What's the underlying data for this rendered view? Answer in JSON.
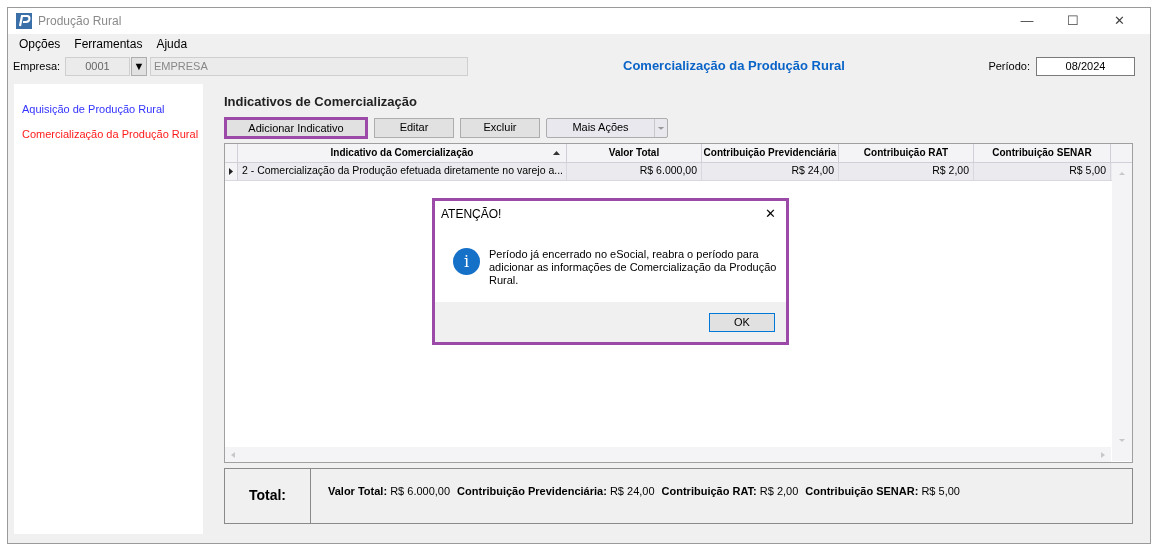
{
  "window": {
    "title": "Produção Rural",
    "controls": [
      "—",
      "☐",
      "✕"
    ]
  },
  "menu": [
    "Opções",
    "Ferramentas",
    "Ajuda"
  ],
  "empresa": {
    "label": "Empresa:",
    "code": "0001",
    "dropdown": "▼",
    "name": "EMPRESA"
  },
  "heading": "Comercialização da Produção Rural",
  "periodo": {
    "label": "Período:",
    "value": "08/2024"
  },
  "sidebar": {
    "items": [
      {
        "label": "Aquisição de Produção Rural",
        "selected": false
      },
      {
        "label": "Comercialização da Produção Rural",
        "selected": true
      }
    ]
  },
  "section_title": "Indicativos de Comercialização",
  "toolbar": {
    "buttons": [
      {
        "label": "Adicionar Indicativo",
        "highlighted": true
      },
      {
        "label": "Editar",
        "highlighted": false
      },
      {
        "label": "Excluir",
        "highlighted": false
      }
    ],
    "more": {
      "label": "Mais Ações"
    }
  },
  "table": {
    "columns": [
      {
        "label": "Indicativo da Comercialização",
        "sorted": true
      },
      {
        "label": "Valor Total",
        "sorted": false
      },
      {
        "label": "Contribuição Previdenciária",
        "sorted": false
      },
      {
        "label": "Contribuição RAT",
        "sorted": false
      },
      {
        "label": "Contribuição SENAR",
        "sorted": false
      }
    ],
    "rows": [
      {
        "selected": true,
        "cells": [
          "2 - Comercialização da Produção efetuada diretamente no varejo a...",
          "R$ 6.000,00",
          "R$ 24,00",
          "R$ 2,00",
          "R$ 5,00"
        ]
      }
    ]
  },
  "totals": {
    "label": "Total:",
    "items": [
      {
        "label": "Valor Total:",
        "value": "R$ 6.000,00"
      },
      {
        "label": "Contribuição Previdenciária:",
        "value": "R$ 24,00"
      },
      {
        "label": "Contribuição RAT:",
        "value": "R$ 2,00"
      },
      {
        "label": "Contribuição SENAR:",
        "value": "R$ 5,00"
      }
    ]
  },
  "dialog": {
    "title": "ATENÇÃO!",
    "close": "✕",
    "icon": "i",
    "message": "Período já encerrado no eSocial, reabra o período para adicionar as informações de Comercialização da Produção Rural.",
    "button": "OK"
  }
}
